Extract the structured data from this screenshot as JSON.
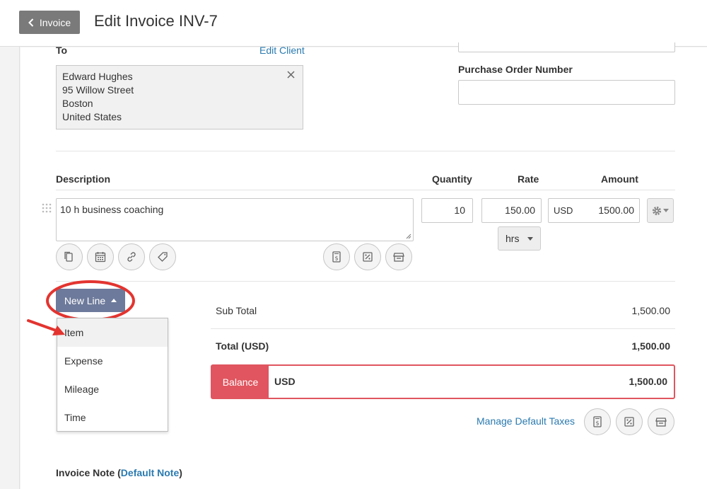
{
  "header": {
    "back_label": "Invoice",
    "title": "Edit Invoice INV-7"
  },
  "client": {
    "label": "To",
    "edit_link": "Edit Client",
    "name": "Edward Hughes",
    "street": "95 Willow Street",
    "city": "Boston",
    "country": "United States"
  },
  "purchase_order": {
    "label": "Purchase Order Number",
    "value": ""
  },
  "line_headers": {
    "description": "Description",
    "quantity": "Quantity",
    "rate": "Rate",
    "amount": "Amount"
  },
  "line_item": {
    "description": "10 h business coaching",
    "quantity": "10",
    "rate": "150.00",
    "unit": "hrs",
    "currency": "USD",
    "amount": "1500.00"
  },
  "new_line": {
    "label": "New Line",
    "options": [
      "Item",
      "Expense",
      "Mileage",
      "Time"
    ],
    "highlighted": "Item"
  },
  "totals": {
    "sub_total_label": "Sub Total",
    "sub_total": "1,500.00",
    "total_label": "Total (USD)",
    "total": "1,500.00",
    "balance_label": "Balance",
    "balance_currency": "USD",
    "balance": "1,500.00"
  },
  "taxes": {
    "manage_link": "Manage Default Taxes"
  },
  "invoice_note": {
    "label": "Invoice Note (",
    "link": "Default Note",
    "suffix": ")"
  },
  "colors": {
    "accent_link": "#2a7ab0",
    "balance_red": "#e0555f",
    "button_slate": "#6d7a9b",
    "annotation_red": "#e3342f"
  }
}
